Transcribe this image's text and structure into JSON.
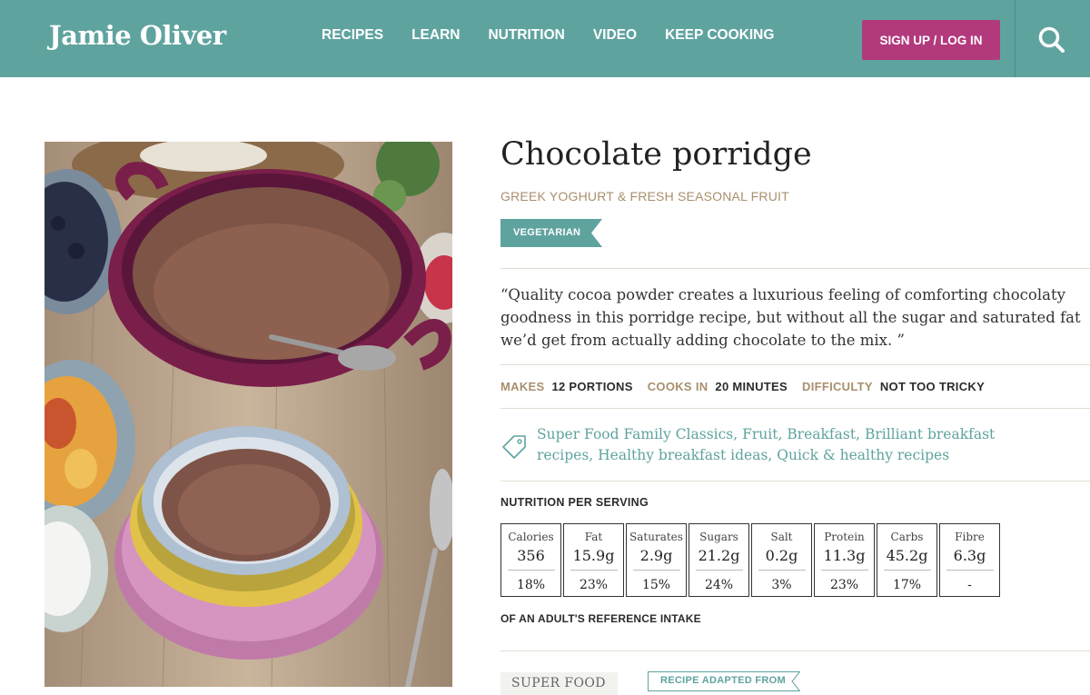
{
  "header": {
    "logo": "Jamie Oliver",
    "nav": [
      "RECIPES",
      "LEARN",
      "NUTRITION",
      "VIDEO",
      "KEEP COOKING"
    ],
    "signup": "SIGN UP / LOG IN",
    "search_icon": "search-icon"
  },
  "recipe": {
    "title": "Chocolate porridge",
    "subtitle": "GREEK YOGHURT & FRESH SEASONAL FRUIT",
    "tag": "VEGETARIAN",
    "quote": "“Quality cocoa powder creates a luxurious feeling of comforting chocolaty goodness in this porridge recipe, but without all the sugar and saturated fat we’d get from actually adding chocolate to the mix. ”",
    "meta": {
      "makes_label": "MAKES",
      "makes_value": "12 PORTIONS",
      "cooks_label": "COOKS IN",
      "cooks_value": "20 MINUTES",
      "difficulty_label": "DIFFICULTY",
      "difficulty_value": "NOT TOO TRICKY"
    },
    "tags_icon": "price-tag-icon",
    "tags": [
      "Super Food Family Classics,",
      "Fruit,",
      "Breakfast,",
      "Brilliant breakfast recipes,",
      "Healthy breakfast ideas,",
      "Quick & healthy recipes"
    ]
  },
  "nutrition": {
    "title": "NUTRITION PER SERVING",
    "items": [
      {
        "label": "Calories",
        "value": "356",
        "pct": "18%"
      },
      {
        "label": "Fat",
        "value": "15.9g",
        "pct": "23%"
      },
      {
        "label": "Saturates",
        "value": "2.9g",
        "pct": "15%"
      },
      {
        "label": "Sugars",
        "value": "21.2g",
        "pct": "24%"
      },
      {
        "label": "Salt",
        "value": "0.2g",
        "pct": "3%"
      },
      {
        "label": "Protein",
        "value": "11.3g",
        "pct": "23%"
      },
      {
        "label": "Carbs",
        "value": "45.2g",
        "pct": "17%"
      },
      {
        "label": "Fibre",
        "value": "6.3g",
        "pct": "-"
      }
    ],
    "footnote": "OF AN ADULT'S REFERENCE INTAKE"
  },
  "source": {
    "book_text": "SUPER FOOD",
    "adapted_label": "RECIPE ADAPTED FROM"
  },
  "colors": {
    "brand_teal": "#5fa39f",
    "signup_magenta": "#b3397d",
    "label_tan": "#a98f6e"
  }
}
